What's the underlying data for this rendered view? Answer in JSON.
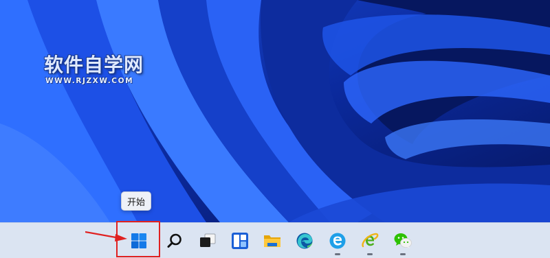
{
  "watermark": {
    "title": "软件自学网",
    "url": "WWW.RJZXW.COM"
  },
  "tooltip": {
    "text": "开始"
  },
  "taskbar": {
    "items": [
      {
        "name": "start-button",
        "icon": "windows-logo-icon"
      },
      {
        "name": "search-button",
        "icon": "search-icon"
      },
      {
        "name": "task-view-button",
        "icon": "task-view-icon"
      },
      {
        "name": "widgets-button",
        "icon": "widgets-icon"
      },
      {
        "name": "file-explorer-button",
        "icon": "folder-icon"
      },
      {
        "name": "edge-button",
        "icon": "edge-icon"
      },
      {
        "name": "browser-button",
        "icon": "browser-e-icon",
        "running": true
      },
      {
        "name": "ie-button",
        "icon": "ie-icon",
        "running": true
      },
      {
        "name": "wechat-button",
        "icon": "wechat-icon",
        "running": true
      }
    ]
  },
  "colors": {
    "annotation": "#e02020",
    "taskbar": "#dbe4f2",
    "wallpaper_accent": "#1f5cff"
  }
}
